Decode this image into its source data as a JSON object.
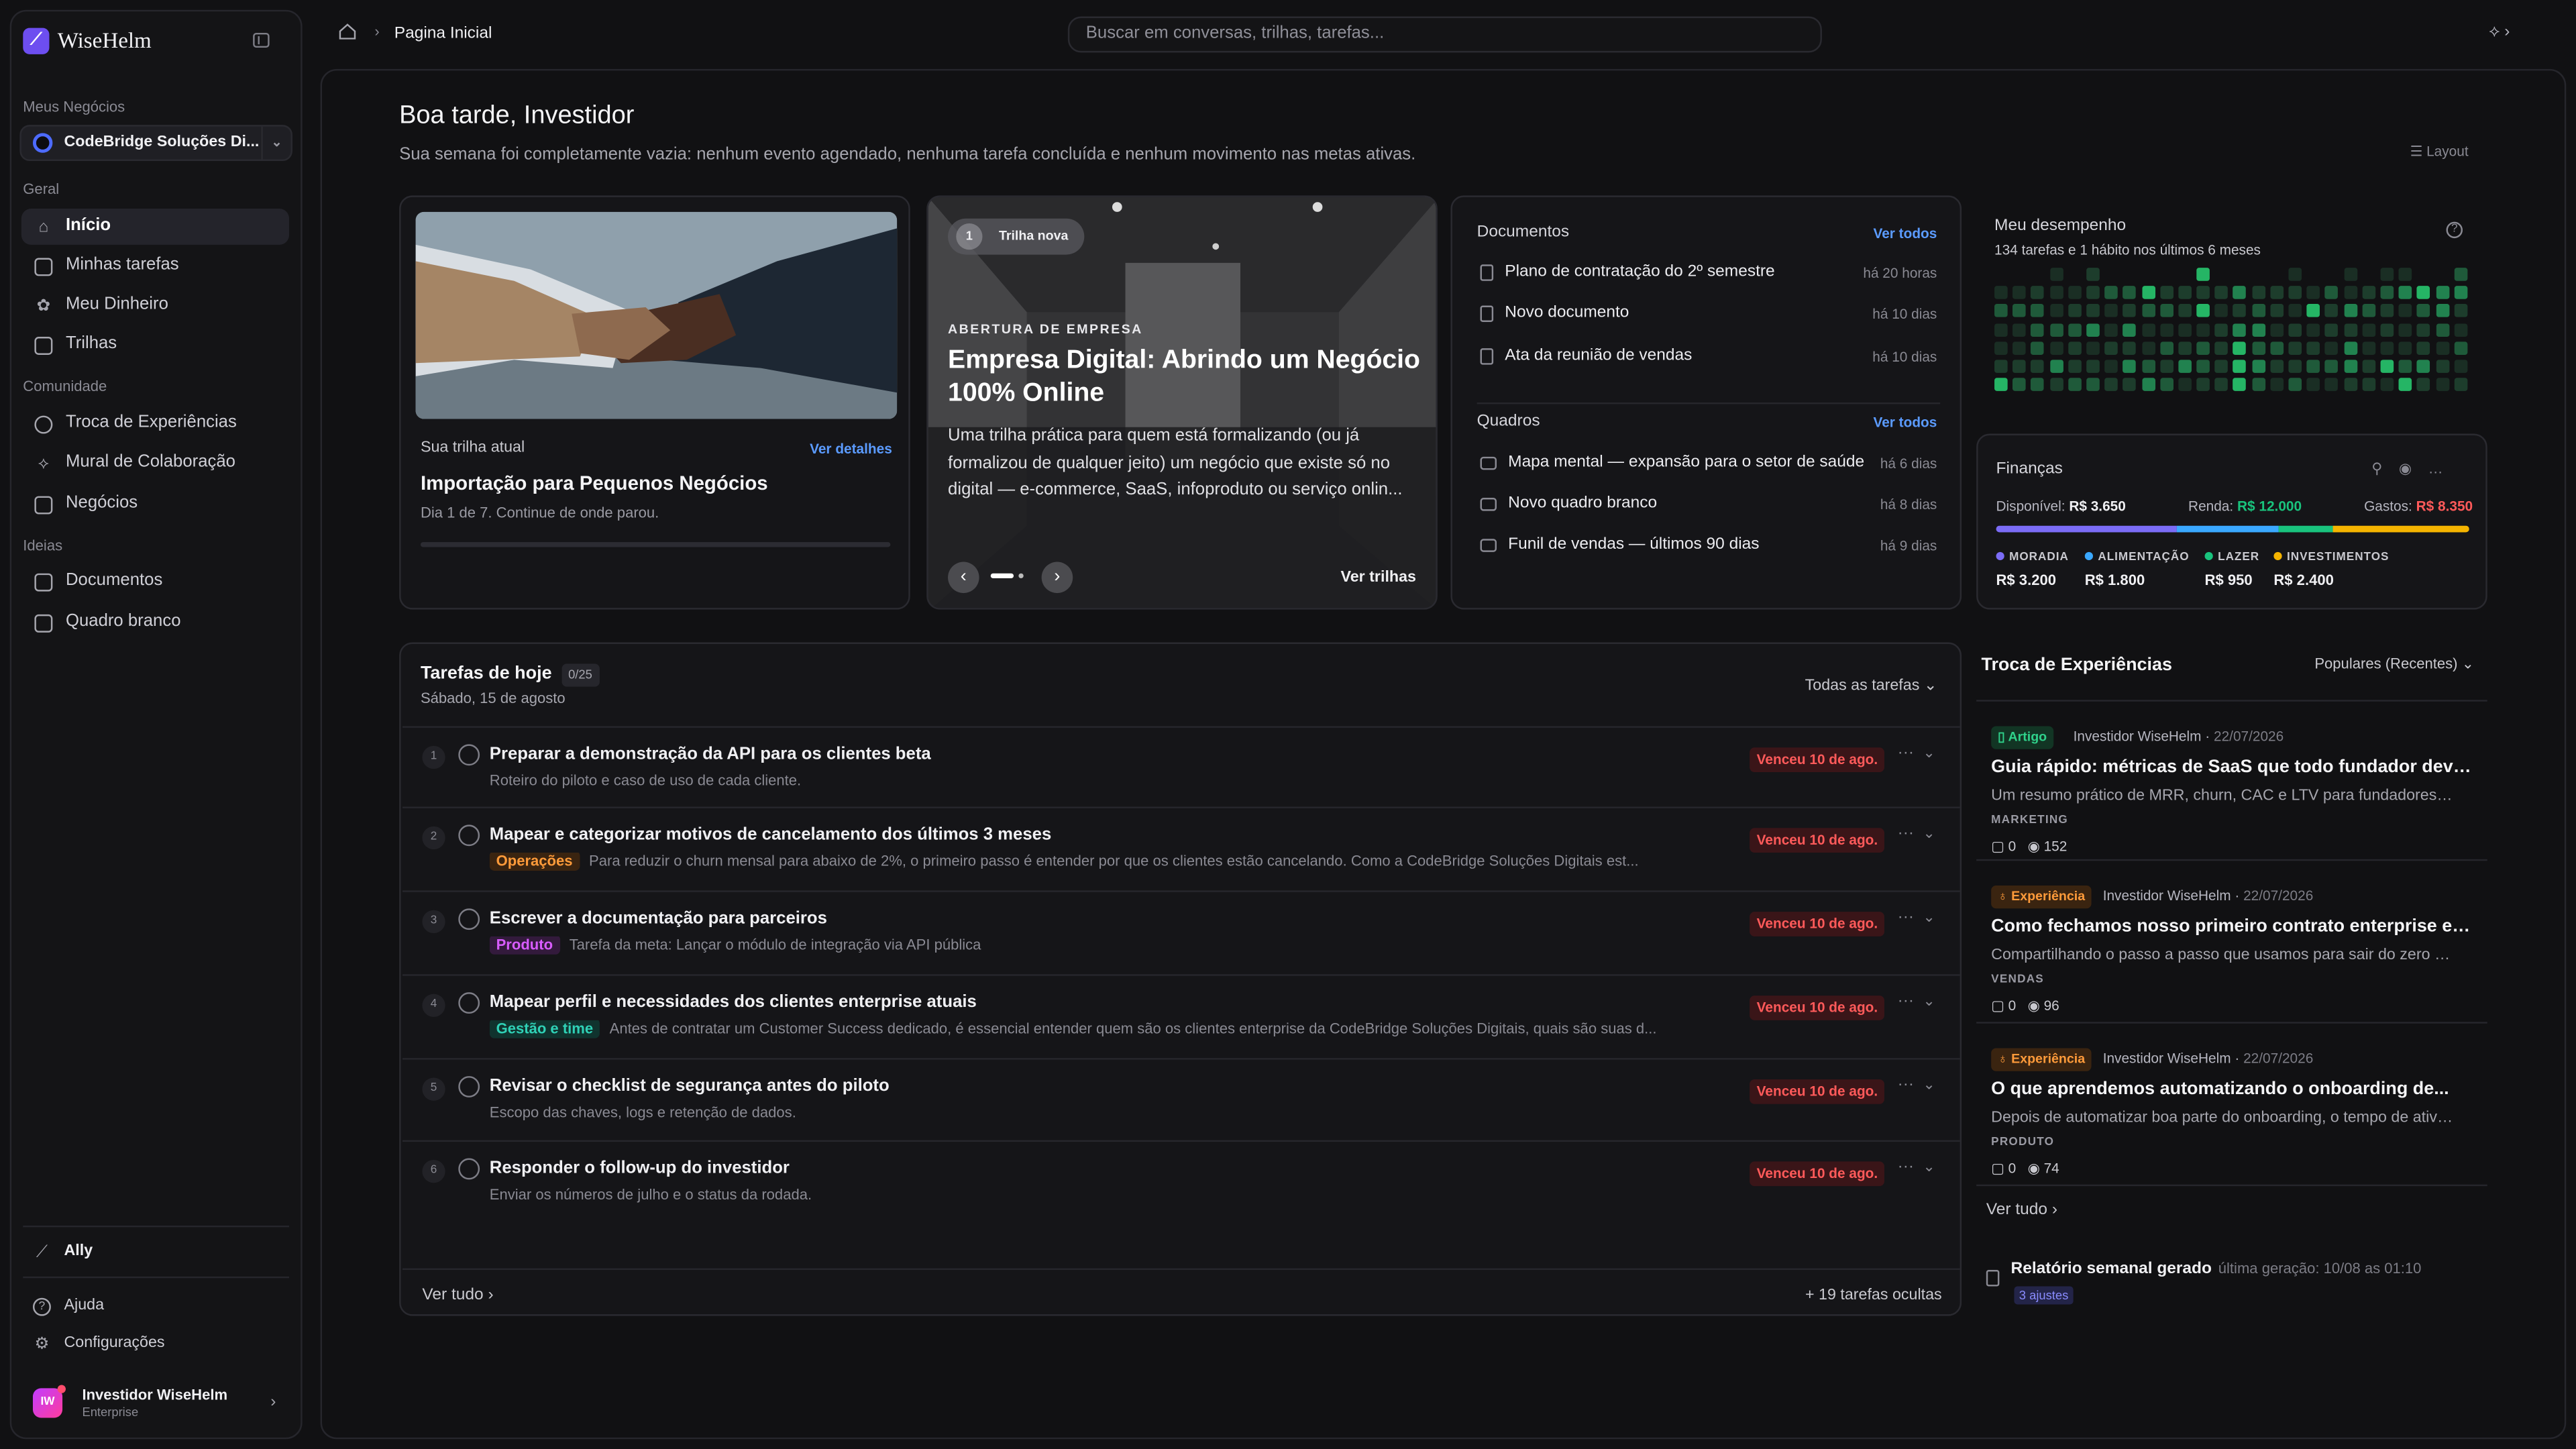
{
  "app": {
    "name": "WiseHelm"
  },
  "sidebar": {
    "section_business": "Meus Negócios",
    "business": "CodeBridge Soluções Di...",
    "section_general": "Geral",
    "general_items": [
      "Início",
      "Minhas tarefas",
      "Meu Dinheiro",
      "Trilhas"
    ],
    "section_community": "Comunidade",
    "community_items": [
      "Troca de Experiências",
      "Mural de Colaboração",
      "Negócios"
    ],
    "section_ideas": "Ideias",
    "ideas_items": [
      "Documentos",
      "Quadro branco"
    ],
    "ally": "Ally",
    "help": "Ajuda",
    "settings": "Configurações",
    "user": {
      "initials": "IW",
      "name": "Investidor WiseHelm",
      "plan": "Enterprise"
    }
  },
  "topbar": {
    "breadcrumb": "Pagina Inicial",
    "search_placeholder": "Buscar em conversas, trilhas, tarefas..."
  },
  "header": {
    "greeting": "Boa tarde, Investidor",
    "summary": "Sua semana foi completamente vazia: nenhum evento agendado, nenhuma tarefa concluída e nenhum movimento nas metas ativas.",
    "layout_label": "Layout"
  },
  "current_track": {
    "label": "Sua trilha atual",
    "link": "Ver detalhes",
    "title": "Importação para Pequenos Negócios",
    "progress_text": "Dia 1 de 7. Continue de onde parou.",
    "progress": 0
  },
  "new_track": {
    "badge_num": "1",
    "badge": "Trilha nova",
    "kicker": "ABERTURA DE EMPRESA",
    "title": "Empresa Digital: Abrindo um Negócio 100% Online",
    "description": "Uma trilha prática para quem está formalizando (ou já formalizou de qualquer jeito) um negócio que existe só no digital — e-commerce, SaaS, infoproduto ou serviço onlin...",
    "link": "Ver trilhas"
  },
  "documents": {
    "title": "Documentos",
    "link": "Ver todos",
    "items": [
      {
        "name": "Plano de contratação do 2º semestre",
        "time": "há 20 horas"
      },
      {
        "name": "Novo documento",
        "time": "há 10 dias"
      },
      {
        "name": "Ata da reunião de vendas",
        "time": "há 10 dias"
      }
    ]
  },
  "boards": {
    "title": "Quadros",
    "link": "Ver todos",
    "items": [
      {
        "name": "Mapa mental — expansão para o setor de saúde",
        "time": "há 6 dias"
      },
      {
        "name": "Novo quadro branco",
        "time": "há 8 dias"
      },
      {
        "name": "Funil de vendas — últimos 90 dias",
        "time": "há 9 dias"
      }
    ]
  },
  "performance": {
    "title": "Meu desempenho",
    "subtitle": "134 tarefas e 1 hábito nos últimos 6 meses"
  },
  "finances": {
    "title": "Finanças",
    "available_label": "Disponível:",
    "available": "R$ 3.650",
    "income_label": "Renda:",
    "income": "R$ 12.000",
    "expenses_label": "Gastos:",
    "expenses": "R$ 8.350",
    "categories": [
      {
        "name": "MORADIA",
        "value": "R$ 3.200",
        "color": "#7b6cf6"
      },
      {
        "name": "ALIMENTAÇÃO",
        "value": "R$ 1.800",
        "color": "#3aa8ff"
      },
      {
        "name": "LAZER",
        "value": "R$ 950",
        "color": "#19c37d"
      },
      {
        "name": "INVESTIMENTOS",
        "value": "R$ 2.400",
        "color": "#f5b400"
      }
    ]
  },
  "tasks": {
    "title": "Tarefas de hoje",
    "count": "0/25",
    "date": "Sábado, 15 de agosto",
    "filter": "Todas as tarefas",
    "items": [
      {
        "num": "1",
        "title": "Preparar a demonstração da API para os clientes beta",
        "tag": "",
        "desc": "Roteiro do piloto e caso de uso de cada cliente.",
        "due": "Venceu 10 de ago."
      },
      {
        "num": "2",
        "title": "Mapear e categorizar motivos de cancelamento dos últimos 3 meses",
        "tag": "Operações",
        "desc": "Para reduzir o churn mensal para abaixo de 2%, o primeiro passo é entender por que os clientes estão cancelando. Como a CodeBridge Soluções Digitais est...",
        "due": "Venceu 10 de ago."
      },
      {
        "num": "3",
        "title": "Escrever a documentação para parceiros",
        "tag": "Produto",
        "desc": "Tarefa da meta: Lançar o módulo de integração via API pública",
        "due": "Venceu 10 de ago."
      },
      {
        "num": "4",
        "title": "Mapear perfil e necessidades dos clientes enterprise atuais",
        "tag": "Gestão e time",
        "desc": "Antes de contratar um Customer Success dedicado, é essencial entender quem são os clientes enterprise da CodeBridge Soluções Digitais, quais são suas d...",
        "due": "Venceu 10 de ago."
      },
      {
        "num": "5",
        "title": "Revisar o checklist de segurança antes do piloto",
        "tag": "",
        "desc": "Escopo das chaves, logs e retenção de dados.",
        "due": "Venceu 10 de ago."
      },
      {
        "num": "6",
        "title": "Responder o follow-up do investidor",
        "tag": "",
        "desc": "Enviar os números de julho e o status da rodada.",
        "due": "Venceu 10 de ago."
      }
    ],
    "see_all": "Ver tudo",
    "hidden": "+ 19 tarefas ocultas"
  },
  "exchange": {
    "title": "Troca de Experiências",
    "filter": "Populares (Recentes)",
    "items": [
      {
        "badge": "Artigo",
        "author": "Investidor WiseHelm",
        "date": "22/07/2026",
        "title": "Guia rápido: métricas de SaaS que todo fundador deveri...",
        "desc": "Um resumo prático de MRR, churn, CAC e LTV para fundadores de...",
        "category": "MARKETING",
        "comments": "0",
        "views": "152"
      },
      {
        "badge": "Experiência",
        "author": "Investidor WiseHelm",
        "date": "22/07/2026",
        "title": "Como fechamos nosso primeiro contrato enterprise em...",
        "desc": "Compartilhando o passo a passo que usamos para sair do zero e fech...",
        "category": "VENDAS",
        "comments": "0",
        "views": "96"
      },
      {
        "badge": "Experiência",
        "author": "Investidor WiseHelm",
        "date": "22/07/2026",
        "title": "O que aprendemos automatizando o onboarding de...",
        "desc": "Depois de automatizar boa parte do onboarding, o tempo de ativação...",
        "category": "PRODUTO",
        "comments": "0",
        "views": "74"
      }
    ],
    "see_all": "Ver tudo"
  },
  "report": {
    "title": "Relatório semanal gerado",
    "subtitle": "última geração: 10/08 as 01:10",
    "badge": "3 ajustes"
  },
  "colors": {
    "accent": "#6d4ef0",
    "link": "#5b9bff",
    "danger": "#ff5a5a",
    "success": "#19c37d"
  }
}
